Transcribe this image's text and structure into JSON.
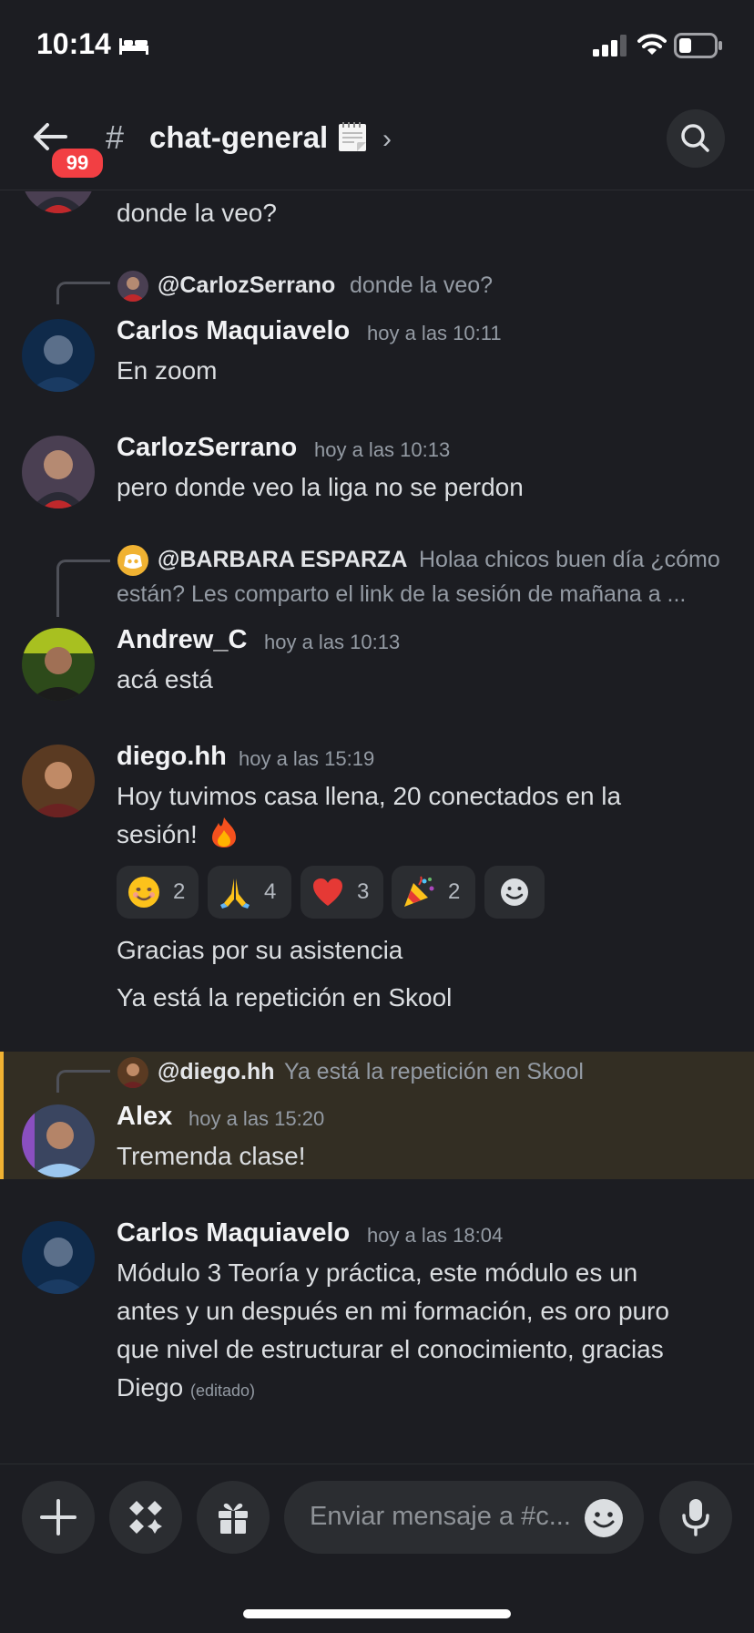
{
  "status_bar": {
    "time": "10:14",
    "battery_level": 0.35
  },
  "header": {
    "unread_badge": "99",
    "channel_name": "chat-general"
  },
  "messages": [
    {
      "text": "donde la veo?"
    },
    {
      "reply": {
        "name": "@CarlozSerrano",
        "text": "donde la veo?"
      },
      "author": "Carlos Maquiavelo",
      "time": "hoy a las 10:11",
      "text": "En zoom"
    },
    {
      "author": "CarlozSerrano",
      "time": "hoy a las 10:13",
      "text": "pero donde veo la liga no se perdon"
    },
    {
      "reply": {
        "name": "@BARBARA ESPARZA",
        "text": "Holaa chicos buen día ¿cómo",
        "text2": "están?  Les comparto el link de la sesión de mañana a ..."
      },
      "author": "Andrew_C",
      "time": "hoy a las 10:13",
      "text": "acá está"
    },
    {
      "author": "diego.hh",
      "time": "hoy a las 15:19",
      "text": "Hoy tuvimos casa llena, 20 conectados en la",
      "text2": "sesión!",
      "reactions": [
        {
          "emoji": "smile-emoji",
          "count": "2"
        },
        {
          "emoji": "pray-emoji",
          "count": "4"
        },
        {
          "emoji": "heart-emoji",
          "count": "3"
        },
        {
          "emoji": "party-emoji",
          "count": "2"
        }
      ],
      "followups": [
        "Gracias por su asistencia",
        "Ya está la repetición en Skool"
      ]
    },
    {
      "reply": {
        "name": "@diego.hh",
        "text": "Ya está la repetición en Skool"
      },
      "author": "Alex",
      "time": "hoy a las 15:20",
      "text": "Tremenda clase!"
    },
    {
      "author": "Carlos Maquiavelo",
      "time": "hoy a las 18:04",
      "lines": [
        "Módulo 3 Teoría y práctica, este  módulo es un",
        "antes y un después en mi formación, es oro puro",
        "que nivel de estructurar el conocimiento, gracias",
        "Diego"
      ],
      "edited": "(editado)"
    }
  ],
  "composer": {
    "placeholder": "Enviar mensaje a #c..."
  },
  "colors": {
    "background": "#1c1d22",
    "mention_highlight": "#332e23",
    "mention_bar": "#f0b232",
    "badge": "#f23f43"
  }
}
